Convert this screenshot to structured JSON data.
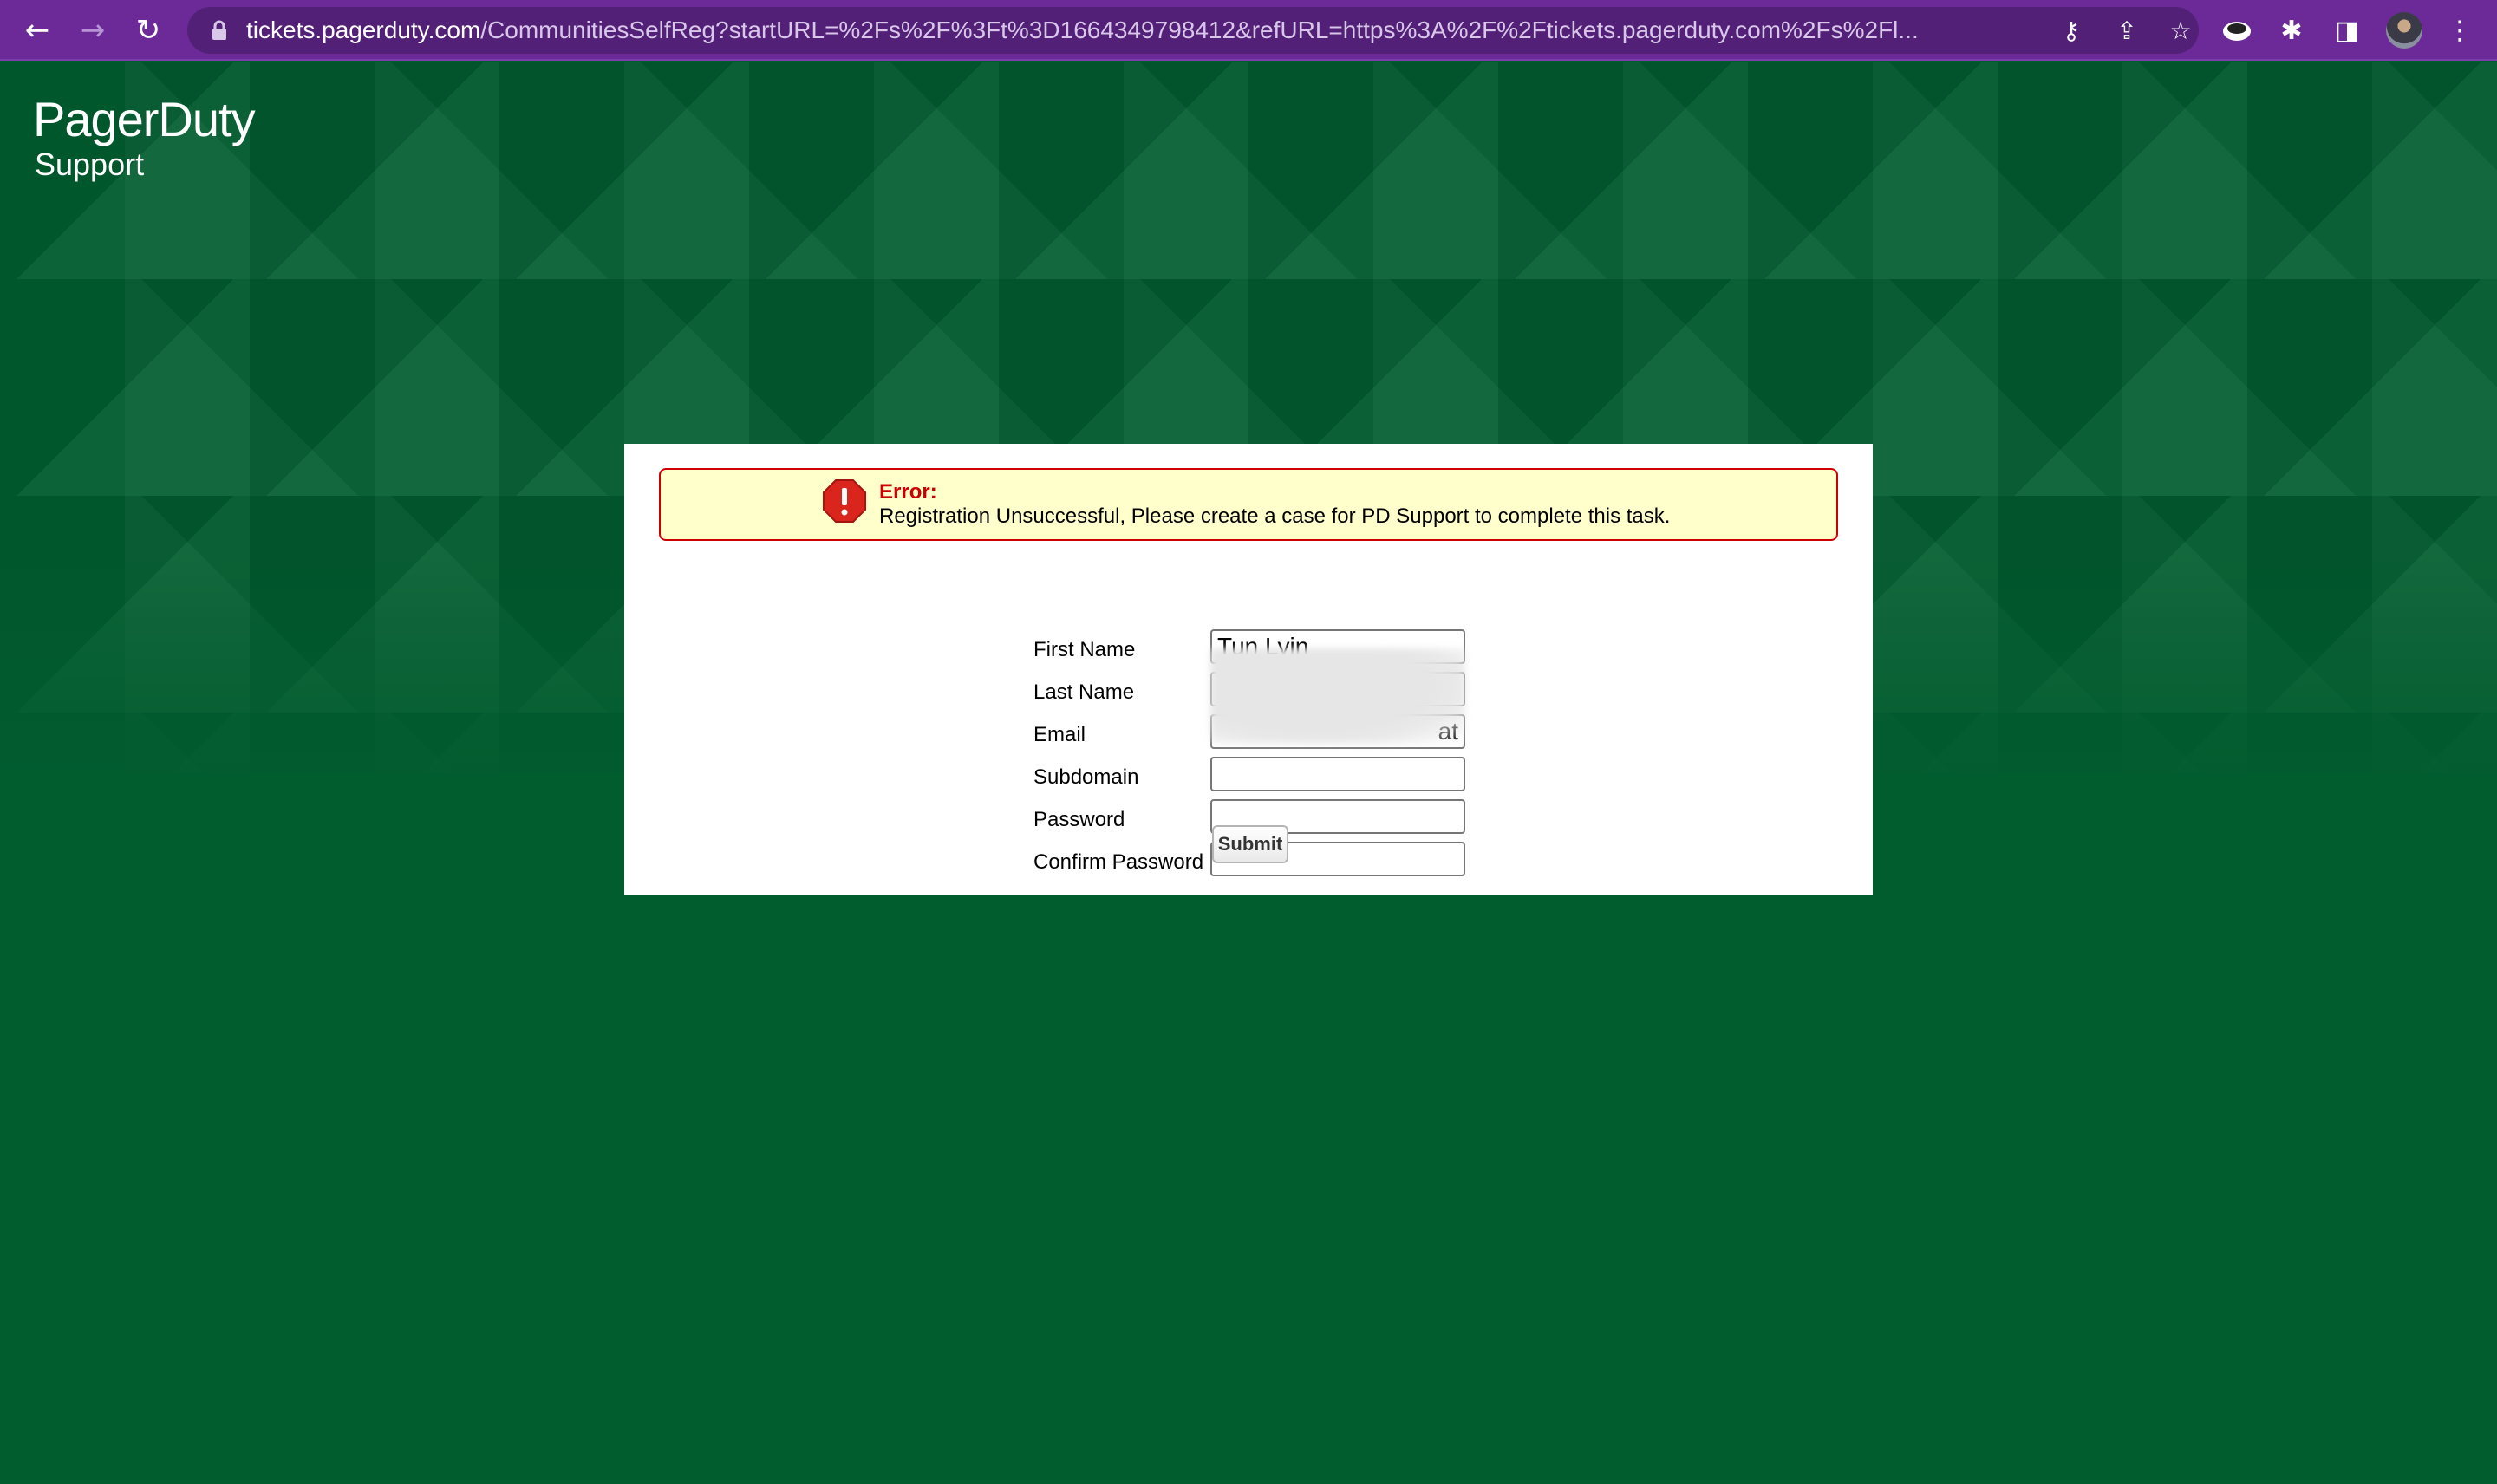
{
  "browser": {
    "url_host": "tickets.pagerduty.com",
    "url_path": "/CommunitiesSelfReg?startURL=%2Fs%2F%3Ft%3D1664349798412&refURL=https%3A%2F%2Ftickets.pagerduty.com%2Fs%2Fl...",
    "icons": {
      "back": "←",
      "forward": "→",
      "reload": "↻",
      "key": "⚷",
      "share": "⇪",
      "star": "☆",
      "extension": "✱",
      "sidepanel": "◨",
      "menu": "⋮"
    }
  },
  "logo": {
    "brand": "PagerDuty",
    "sub": "Support"
  },
  "error": {
    "title": "Error:",
    "message": "Registration Unsuccessful, Please create a case for PD Support to complete this task."
  },
  "form": {
    "first_name_label": "First Name",
    "first_name_value": "Tun Lyin",
    "last_name_label": "Last Name",
    "last_name_value": "Aung",
    "email_label": "Email",
    "email_value": "at",
    "subdomain_label": "Subdomain",
    "subdomain_value": "",
    "password_label": "Password",
    "password_value": "",
    "confirm_password_label": "Confirm Password",
    "confirm_password_value": "",
    "submit_label": "Submit"
  },
  "colors": {
    "toolbar": "#6b2a98",
    "page_background": "#015c2e",
    "error_border": "#cc0000",
    "error_background": "#ffffcc"
  }
}
